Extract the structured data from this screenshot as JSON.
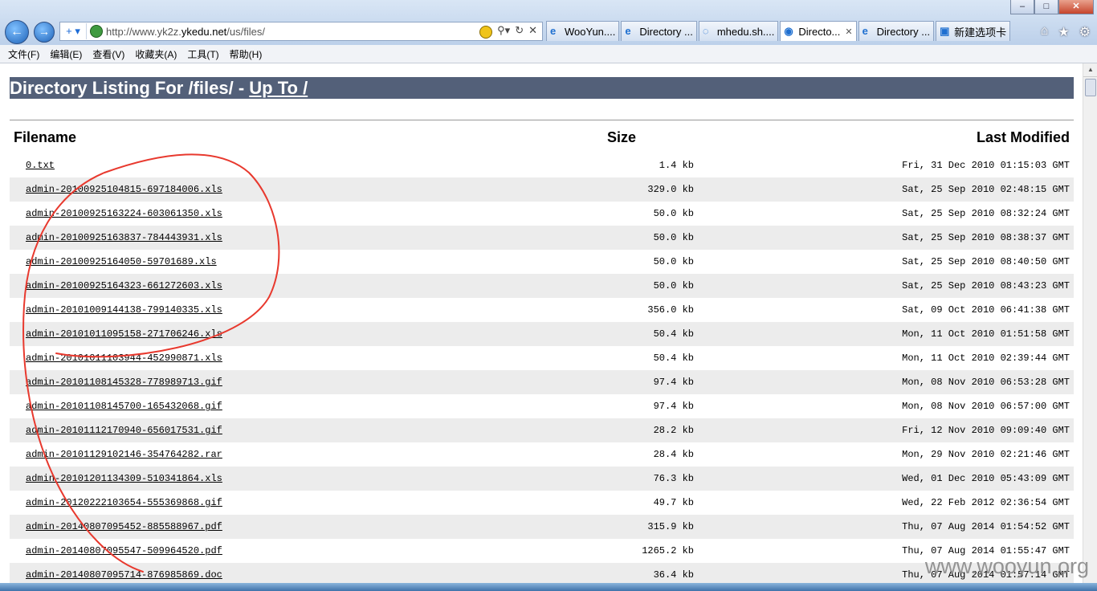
{
  "browser": {
    "address_prefix": "http://www.yk2z.",
    "address_domain": "ykedu.net",
    "address_path": "/us/files/",
    "tabs": [
      {
        "label": "WooYun....",
        "active": false,
        "icon": "ie-icon"
      },
      {
        "label": "Directory ...",
        "active": false,
        "icon": "ie-icon"
      },
      {
        "label": "mhedu.sh....",
        "active": false,
        "icon": "loading-icon"
      },
      {
        "label": "Directo...",
        "active": true,
        "icon": "site-icon"
      },
      {
        "label": "Directory ...",
        "active": false,
        "icon": "ie-icon"
      },
      {
        "label": "新建选项卡",
        "active": false,
        "icon": "new-tab-icon"
      }
    ],
    "menu": [
      "文件(F)",
      "编辑(E)",
      "查看(V)",
      "收藏夹(A)",
      "工具(T)",
      "帮助(H)"
    ]
  },
  "page": {
    "heading_prefix": "Directory Listing For /files/ - ",
    "heading_link": "Up To /",
    "columns": {
      "filename": "Filename",
      "size": "Size",
      "modified": "Last Modified"
    },
    "files": [
      {
        "name": "0.txt",
        "size": "1.4 kb",
        "modified": "Fri, 31 Dec 2010 01:15:03 GMT"
      },
      {
        "name": "admin-20100925104815-697184006.xls",
        "size": "329.0 kb",
        "modified": "Sat, 25 Sep 2010 02:48:15 GMT"
      },
      {
        "name": "admin-20100925163224-603061350.xls",
        "size": "50.0 kb",
        "modified": "Sat, 25 Sep 2010 08:32:24 GMT"
      },
      {
        "name": "admin-20100925163837-784443931.xls",
        "size": "50.0 kb",
        "modified": "Sat, 25 Sep 2010 08:38:37 GMT"
      },
      {
        "name": "admin-20100925164050-59701689.xls",
        "size": "50.0 kb",
        "modified": "Sat, 25 Sep 2010 08:40:50 GMT"
      },
      {
        "name": "admin-20100925164323-661272603.xls",
        "size": "50.0 kb",
        "modified": "Sat, 25 Sep 2010 08:43:23 GMT"
      },
      {
        "name": "admin-20101009144138-799140335.xls",
        "size": "356.0 kb",
        "modified": "Sat, 09 Oct 2010 06:41:38 GMT"
      },
      {
        "name": "admin-20101011095158-271706246.xls",
        "size": "50.4 kb",
        "modified": "Mon, 11 Oct 2010 01:51:58 GMT"
      },
      {
        "name": "admin-20101011103944-452990871.xls",
        "size": "50.4 kb",
        "modified": "Mon, 11 Oct 2010 02:39:44 GMT"
      },
      {
        "name": "admin-20101108145328-778989713.gif",
        "size": "97.4 kb",
        "modified": "Mon, 08 Nov 2010 06:53:28 GMT"
      },
      {
        "name": "admin-20101108145700-165432068.gif",
        "size": "97.4 kb",
        "modified": "Mon, 08 Nov 2010 06:57:00 GMT"
      },
      {
        "name": "admin-20101112170940-656017531.gif",
        "size": "28.2 kb",
        "modified": "Fri, 12 Nov 2010 09:09:40 GMT"
      },
      {
        "name": "admin-20101129102146-354764282.rar",
        "size": "28.4 kb",
        "modified": "Mon, 29 Nov 2010 02:21:46 GMT"
      },
      {
        "name": "admin-20101201134309-510341864.xls",
        "size": "76.3 kb",
        "modified": "Wed, 01 Dec 2010 05:43:09 GMT"
      },
      {
        "name": "admin-20120222103654-555369868.gif",
        "size": "49.7 kb",
        "modified": "Wed, 22 Feb 2012 02:36:54 GMT"
      },
      {
        "name": "admin-20140807095452-885588967.pdf",
        "size": "315.9 kb",
        "modified": "Thu, 07 Aug 2014 01:54:52 GMT"
      },
      {
        "name": "admin-20140807095547-509964520.pdf",
        "size": "1265.2 kb",
        "modified": "Thu, 07 Aug 2014 01:55:47 GMT"
      },
      {
        "name": "admin-20140807095714-876985869.doc",
        "size": "36.4 kb",
        "modified": "Thu, 07 Aug 2014 01:57:14 GMT"
      }
    ]
  },
  "watermark": "www.wooyun.org",
  "colors": {
    "heading_bg": "#536079",
    "row_alt": "#ececec",
    "annotation": "#e8392e"
  }
}
